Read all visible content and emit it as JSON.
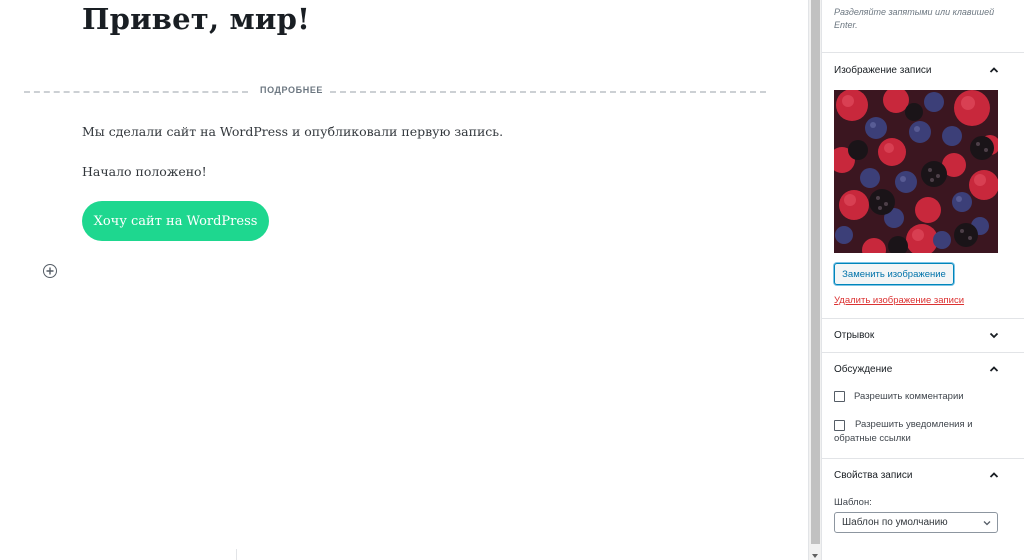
{
  "editor": {
    "post_title": "Привет, мир!",
    "more_label": "ПОДРОБНЕЕ",
    "paragraph_1": "Мы сделали сайт на WordPress и опубликовали первую запись.",
    "paragraph_2": "Начало положено!",
    "cta_button_label": "Хочу сайт на WordPress",
    "cta_button_color": "#1ed78f",
    "inserter_icon": "plus-circle-icon"
  },
  "sidebar": {
    "tags_help": "Разделяйте запятыми или клавишей Enter.",
    "featured_image": {
      "title": "Изображение записи",
      "expanded": true,
      "image_subject": "raspberries and blackberries",
      "replace_label": "Заменить изображение",
      "remove_label": "Удалить изображение записи"
    },
    "excerpt": {
      "title": "Отрывок",
      "expanded": false
    },
    "discussion": {
      "title": "Обсуждение",
      "expanded": true,
      "allow_comments_label": "Разрешить комментарии",
      "allow_comments_checked": false,
      "allow_pings_label": "Разрешить уведомления и обратные ссылки",
      "allow_pings_checked": false
    },
    "post_attributes": {
      "title": "Свойства записи",
      "expanded": true,
      "template_label": "Шаблон:",
      "template_value": "Шаблон по умолчанию"
    }
  },
  "colors": {
    "primary_link": "#0073aa",
    "danger_link": "#dc3232"
  }
}
